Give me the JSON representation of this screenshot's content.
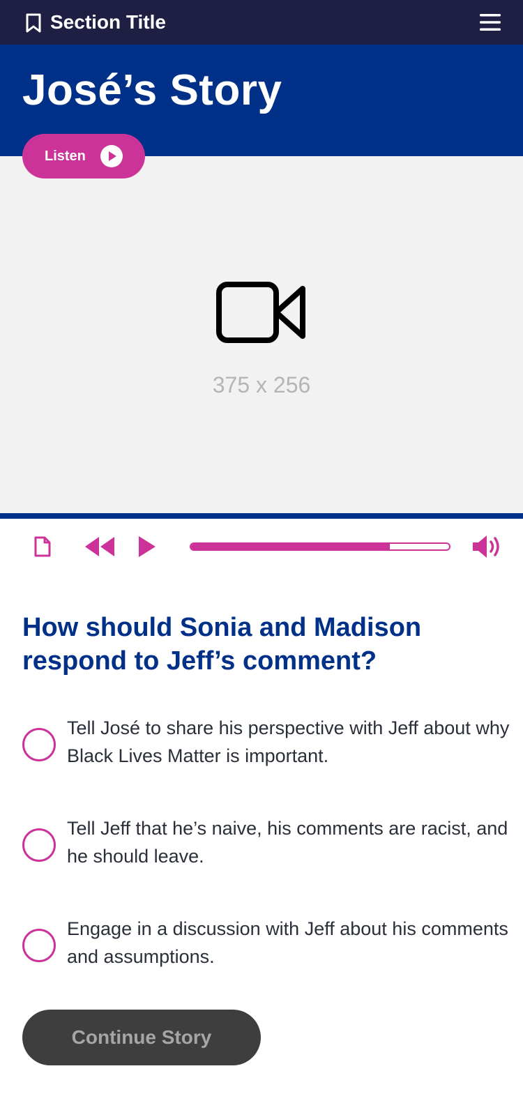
{
  "topbar": {
    "section_title": "Section Title",
    "bookmark_icon": "bookmark-icon",
    "menu_icon": "hamburger-menu-icon"
  },
  "hero": {
    "title": "José’s Story",
    "listen_label": "Listen",
    "listen_icon": "play-circle-icon"
  },
  "video": {
    "placeholder_icon": "video-camera-icon",
    "size_text": "375 x 256"
  },
  "player": {
    "transcript_icon": "document-icon",
    "rewind_icon": "rewind-icon",
    "play_icon": "play-icon",
    "progress": 0.77,
    "volume_icon": "volume-icon"
  },
  "question": {
    "text": "How should Sonia and Madison respond to Jeff’s comment?",
    "options": [
      {
        "label": "Tell José to share his perspective with Jeff about why Black Lives Matter is important."
      },
      {
        "label": "Tell Jeff that he’s naive, his comments are racist, and he should leave."
      },
      {
        "label": "Engage in a discussion with Jeff about his comments and assumptions."
      }
    ]
  },
  "continue": {
    "label": "Continue Story"
  },
  "colors": {
    "topbar": "#1f1f44",
    "brand_blue": "#003087",
    "accent_magenta": "#cc3399",
    "video_bg": "#f2f2f2",
    "button_disabled": "#3e3e3e"
  }
}
